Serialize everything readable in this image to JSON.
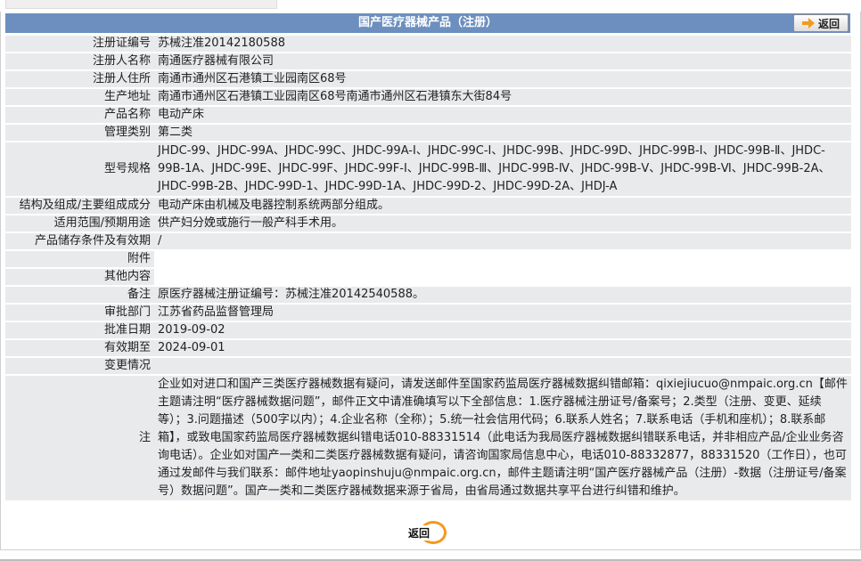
{
  "header": {
    "title": "国产医疗器械产品（注册）",
    "back_label": "返回"
  },
  "rows": [
    {
      "label": "注册证编号",
      "value": "苏械注准20142180588"
    },
    {
      "label": "注册人名称",
      "value": "南通医疗器械有限公司"
    },
    {
      "label": "注册人住所",
      "value": "南通市通州区石港镇工业园南区68号"
    },
    {
      "label": "生产地址",
      "value": "南通市通州区石港镇工业园南区68号南通市通州区石港镇东大街84号"
    },
    {
      "label": "产品名称",
      "value": "电动产床"
    },
    {
      "label": "管理类别",
      "value": "第二类"
    },
    {
      "label": "型号规格",
      "value": "JHDC-99、JHDC-99A、JHDC-99C、JHDC-99A-Ⅰ、JHDC-99C-Ⅰ、JHDC-99B、JHDC-99D、JHDC-99B-Ⅰ、JHDC-99B-Ⅱ、JHDC-99B-1A、JHDC-99E、JHDC-99F、JHDC-99F-Ⅰ、JHDC-99B-Ⅲ、JHDC-99B-Ⅳ、JHDC-99B-Ⅴ、JHDC-99B-Ⅵ、JHDC-99B-2A、JHDC-99B-2B、JHDC-99D-1、JHDC-99D-1A、JHDC-99D-2、JHDC-99D-2A、JHDJ-A"
    },
    {
      "label": "结构及组成/主要组成成分",
      "value": "电动产床由机械及电器控制系统两部分组成。"
    },
    {
      "label": "适用范围/预期用途",
      "value": "供产妇分娩或施行一般产科手术用。"
    },
    {
      "label": "产品储存条件及有效期",
      "value": "/"
    },
    {
      "label": "附件",
      "value": ""
    },
    {
      "label": "其他内容",
      "value": ""
    },
    {
      "label": "备注",
      "value": "原医疗器械注册证编号：苏械注准20142540588。"
    },
    {
      "label": "审批部门",
      "value": "江苏省药品监督管理局"
    },
    {
      "label": "批准日期",
      "value": "2019-09-02"
    },
    {
      "label": "有效期至",
      "value": "2024-09-01"
    },
    {
      "label": "变更情况",
      "value": ""
    },
    {
      "label": "注",
      "value": "企业如对进口和国产三类医疗器械数据有疑问，请发送邮件至国家药监局医疗器械数据纠错邮箱：qixiejiucuo@nmpaic.org.cn【邮件主题请注明“医疗器械数据问题”，邮件正文中请准确填写以下全部信息：1.医疗器械注册证号/备案号；2.类型（注册、变更、延续等）；3.问题描述（500字以内）；4.企业名称（全称）；5.统一社会信用代码；6.联系人姓名；7.联系电话（手机和座机）；8.联系邮箱】，或致电国家药监局医疗器械数据纠错电话010-88331514（此电话为我局医疗器械数据纠错联系电话，并非相应产品/企业业务咨询电话）。企业如对国产一类和二类医疗器械数据有疑问，请咨询国家局信息中心，电话010-88332877，88331520（工作日），也可通过发邮件与我们联系：邮件地址yaopinshuju@nmpaic.org.cn，邮件主题请注明“国产医疗器械产品（注册）-数据（注册证号/备案号）数据问题”。国产一类和二类医疗器械数据来源于省局，由省局通过数据共享平台进行纠错和维护。"
    }
  ],
  "footer": {
    "back_label": "返回"
  },
  "colors": {
    "header_bg": "#6c8fbf",
    "label_bg": "#e9eaec",
    "accent": "#f39a1c"
  }
}
